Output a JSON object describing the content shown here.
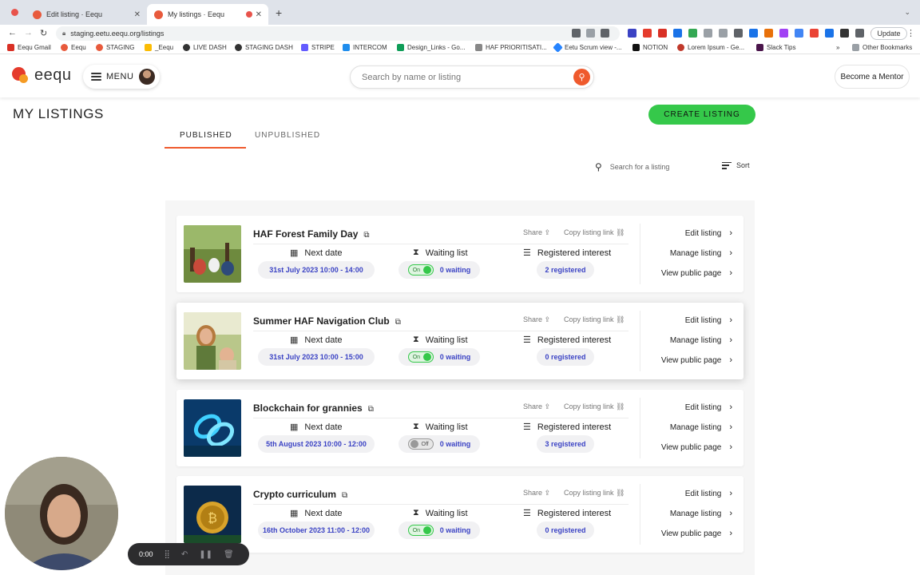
{
  "browser": {
    "tabs": [
      {
        "label": "Edit listing · Eequ"
      },
      {
        "label": "My listings · Eequ"
      }
    ],
    "url": "staging.eetu.eequ.org/listings",
    "update_label": "Update",
    "bookmarks": [
      {
        "label": "Eequ Gmail",
        "color": "#d93025"
      },
      {
        "label": "Eequ",
        "color": "#e85a3c"
      },
      {
        "label": "STAGING",
        "color": "#e85a3c"
      },
      {
        "label": "_Eequ",
        "color": "#fbbc04"
      },
      {
        "label": "LIVE DASH",
        "color": "#333333"
      },
      {
        "label": "STAGING DASH",
        "color": "#333333"
      },
      {
        "label": "STRIPE",
        "color": "#635bff"
      },
      {
        "label": "INTERCOM",
        "color": "#1f8ded"
      },
      {
        "label": "Design_Links - Go...",
        "color": "#0f9d58"
      },
      {
        "label": "HAF PRIORITISATI...",
        "color": "#888888"
      },
      {
        "label": "Eetu Scrum view -...",
        "color": "#2684ff"
      },
      {
        "label": "NOTION",
        "color": "#111111"
      },
      {
        "label": "Lorem Ipsum - Ge...",
        "color": "#c0392b"
      },
      {
        "label": "Slack Tips",
        "color": "#4a154b"
      }
    ],
    "more_bookmarks": "»",
    "other_bookmarks": "Other Bookmarks"
  },
  "header": {
    "logo_text": "eequ",
    "menu_label": "MENU",
    "search_placeholder": "Search by name or listing",
    "mentor_label": "Become a Mentor"
  },
  "page": {
    "title": "MY LISTINGS",
    "create_label": "CREATE LISTING",
    "tabs": [
      {
        "label": "PUBLISHED"
      },
      {
        "label": "UNPUBLISHED"
      }
    ],
    "list_search_placeholder": "Search for a listing",
    "sort_label": "Sort"
  },
  "labels": {
    "share": "Share",
    "copy_link": "Copy listing link",
    "next_date": "Next date",
    "waiting_list": "Waiting list",
    "registered_interest": "Registered interest",
    "edit": "Edit listing",
    "manage": "Manage listing",
    "view": "View public page"
  },
  "listings": [
    {
      "title": "HAF Forest Family Day",
      "date": "31st July 2023 10:00 - 14:00",
      "waitlist_on": true,
      "toggle": "On",
      "waiting": "0 waiting",
      "registered": "2 registered",
      "thumb": "forest"
    },
    {
      "title": "Summer HAF Navigation Club",
      "date": "31st July 2023 10:00 - 15:00",
      "waitlist_on": true,
      "toggle": "On",
      "waiting": "0 waiting",
      "registered": "0 registered",
      "thumb": "kids"
    },
    {
      "title": "Blockchain for grannies",
      "date": "5th August 2023 10:00 - 12:00",
      "waitlist_on": false,
      "toggle": "Off",
      "waiting": "0 waiting",
      "registered": "3 registered",
      "thumb": "chain"
    },
    {
      "title": "Crypto curriculum",
      "date": "16th October 2023 11:00 - 12:00",
      "waitlist_on": true,
      "toggle": "On",
      "waiting": "0 waiting",
      "registered": "0 registered",
      "thumb": "coin"
    }
  ],
  "recorder": {
    "time": "0:00"
  },
  "colors": {
    "accent_orange": "#ef5a2d",
    "create_green": "#35c84a",
    "pill_text": "#3b43c4"
  }
}
